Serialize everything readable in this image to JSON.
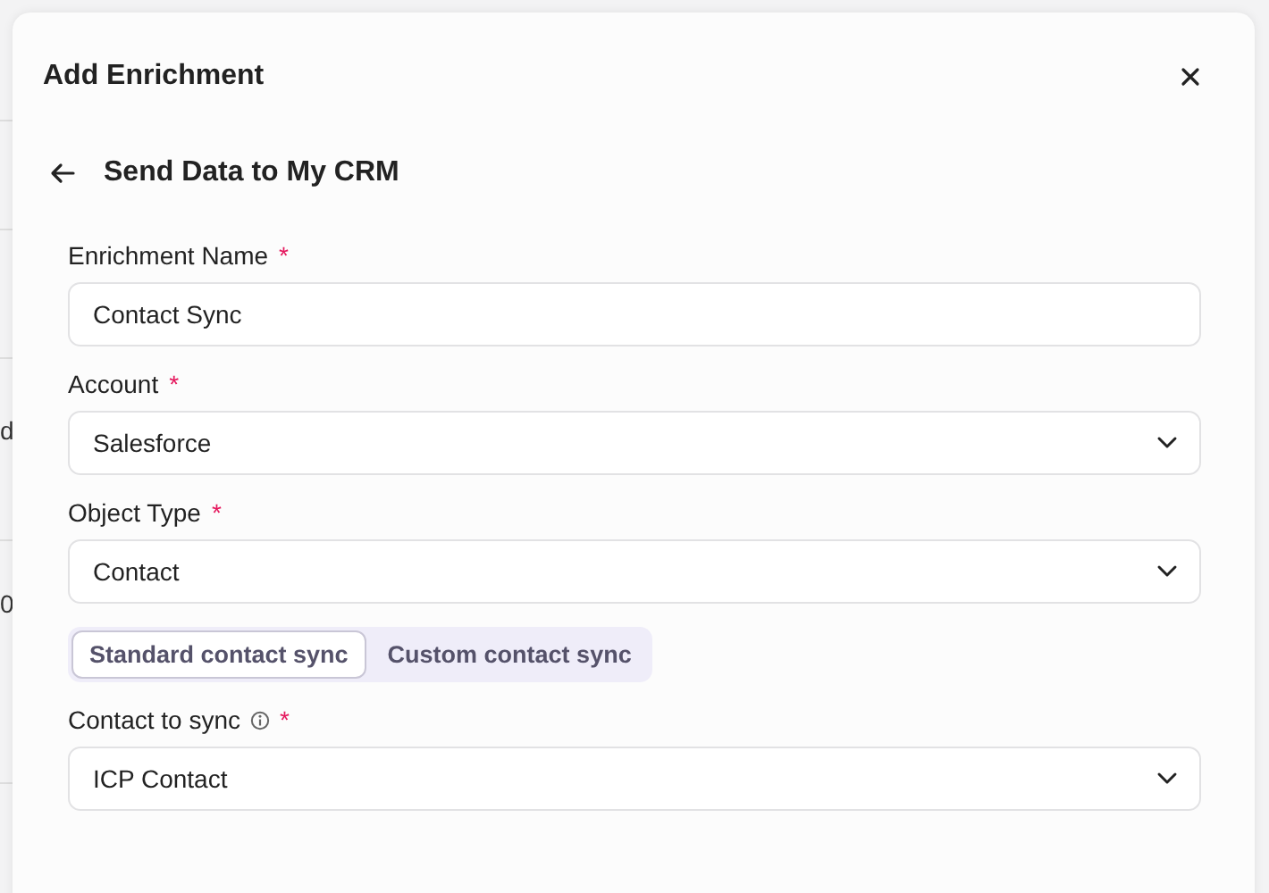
{
  "background": {
    "fragments": [
      "d",
      "0"
    ]
  },
  "dialog": {
    "title": "Add Enrichment",
    "subtitle": "Send Data to My CRM"
  },
  "form": [
    {
      "kind": "text",
      "label": "Enrichment Name",
      "required_mark": "*",
      "info": false,
      "value": "Contact Sync"
    },
    {
      "kind": "select",
      "label": "Account",
      "required_mark": "*",
      "info": false,
      "value": "Salesforce"
    },
    {
      "kind": "select",
      "label": "Object Type",
      "required_mark": "*",
      "info": false,
      "value": "Contact"
    },
    {
      "kind": "toggle",
      "options": [
        {
          "label": "Standard contact sync",
          "selected": true
        },
        {
          "label": "Custom contact sync",
          "selected": false
        }
      ]
    },
    {
      "kind": "select",
      "label": "Contact to sync",
      "required_mark": "*",
      "info": true,
      "value": "ICP Contact"
    }
  ]
}
